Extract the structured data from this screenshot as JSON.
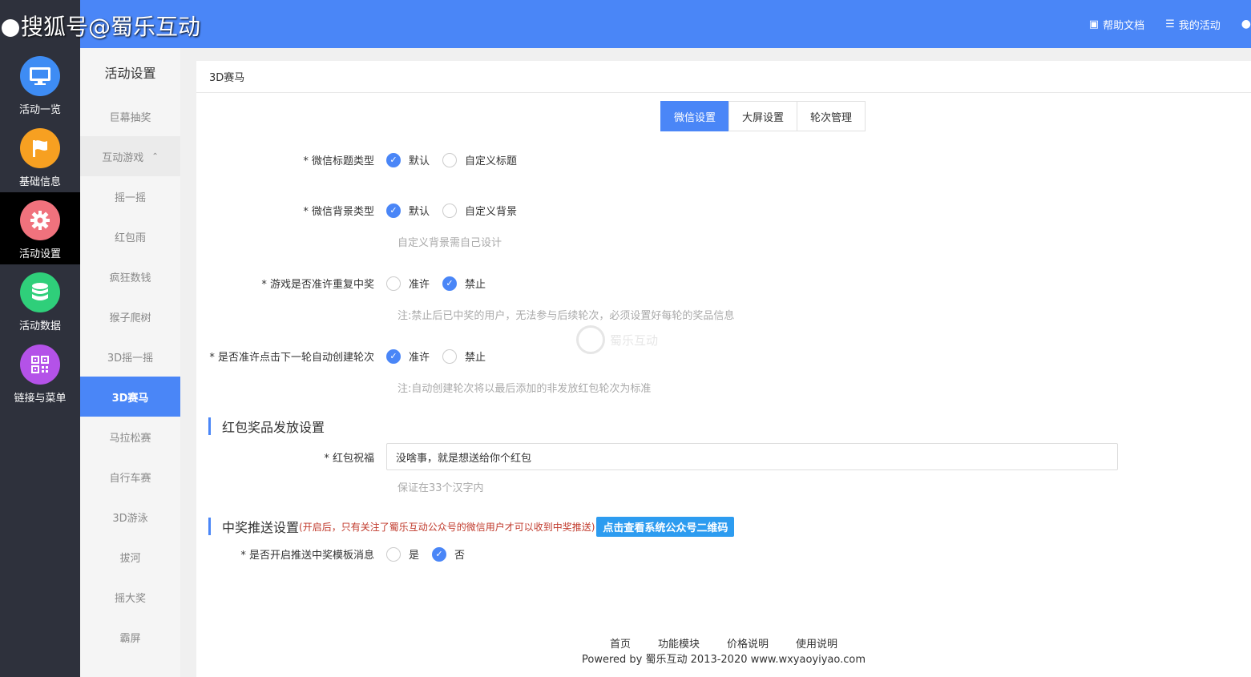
{
  "watermark": "搜狐号@蜀乐互动",
  "top": {
    "help": "帮助文档",
    "my_activity": "我的活动"
  },
  "nav": [
    {
      "label": "活动一览",
      "icon": "monitor-icon",
      "color": "#3e8cf4"
    },
    {
      "label": "基础信息",
      "icon": "flag-icon",
      "color": "#f7a021"
    },
    {
      "label": "活动设置",
      "icon": "gear-icon",
      "color": "#f0727d"
    },
    {
      "label": "活动数据",
      "icon": "database-icon",
      "color": "#2fcf7a"
    },
    {
      "label": "链接与菜单",
      "icon": "qrcode-icon",
      "color": "#b452e8"
    }
  ],
  "subnav": {
    "title": "活动设置",
    "items": [
      "巨幕抽奖",
      "互动游戏",
      "摇一摇",
      "红包雨",
      "疯狂数钱",
      "猴子爬树",
      "3D摇一摇",
      "3D赛马",
      "马拉松赛",
      "自行车赛",
      "3D游泳",
      "拔河",
      "摇大奖",
      "霸屏"
    ]
  },
  "panel": {
    "title": "3D赛马",
    "tabs": [
      "微信设置",
      "大屏设置",
      "轮次管理"
    ],
    "wechat_title_type": {
      "label": "* 微信标题类型",
      "options": [
        "默认",
        "自定义标题"
      ]
    },
    "wechat_bg_type": {
      "label": "* 微信背景类型",
      "options": [
        "默认",
        "自定义背景"
      ],
      "hint": "自定义背景需自己设计"
    },
    "repeat_win": {
      "label": "* 游戏是否准许重复中奖",
      "options": [
        "准许",
        "禁止"
      ],
      "hint": "注:禁止后已中奖的用户，无法参与后续轮次，必须设置好每轮的奖品信息"
    },
    "auto_round": {
      "label": "* 是否准许点击下一轮自动创建轮次",
      "options": [
        "准许",
        "禁止"
      ],
      "hint": "注:自动创建轮次将以最后添加的非发放红包轮次为标准"
    },
    "redpack_section": "红包奖品发放设置",
    "blessing": {
      "label": "* 红包祝福",
      "value": "没啥事，就是想送给你个红包",
      "hint": "保证在33个汉字内"
    },
    "push_section": "中奖推送设置",
    "push_note": "(开启后，只有关注了蜀乐互动公众号的微信用户才可以收到中奖推送)",
    "qr_button": "点击查看系统公众号二维码",
    "push_template": {
      "label": "* 是否开启推送中奖模板消息",
      "options": [
        "是",
        "否"
      ]
    },
    "center_watermark": "蜀乐互动"
  },
  "footer": {
    "links": [
      "首页",
      "功能模块",
      "价格说明",
      "使用说明"
    ],
    "copyright": "Powered by 蜀乐互动 2013-2020 www.wxyaoyiyao.com"
  }
}
